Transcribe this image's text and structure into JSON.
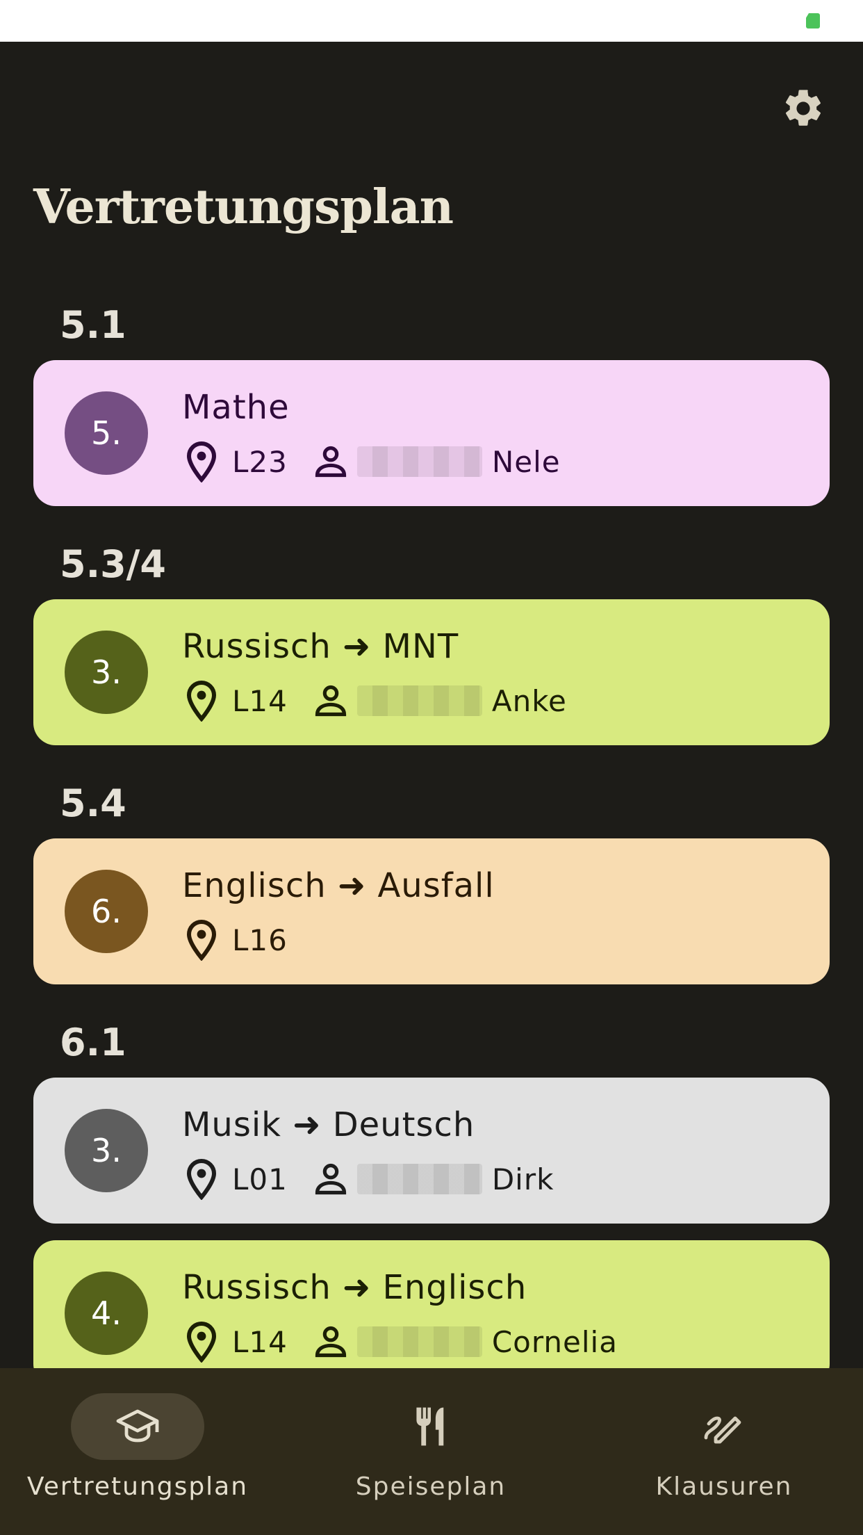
{
  "app": {
    "title": "Vertretungsplan"
  },
  "colors": {
    "background": "#1d1c18",
    "pink_card": "#f7d6f7",
    "green_card": "#d8ea80",
    "orange_card": "#f8dcb1",
    "grey_card": "#e1e1e1",
    "nav_bar": "#2f2a1a"
  },
  "groups": [
    {
      "class": "5.1",
      "entries": [
        {
          "period": "5.",
          "subject": "Mathe",
          "room": "L23",
          "teacher": "Nele",
          "color": "pink"
        }
      ]
    },
    {
      "class": "5.3/4",
      "entries": [
        {
          "period": "3.",
          "subject": "Russisch ➜ MNT",
          "room": "L14",
          "teacher": "Anke",
          "color": "green"
        }
      ]
    },
    {
      "class": "5.4",
      "entries": [
        {
          "period": "6.",
          "subject": "Englisch ➜ Ausfall",
          "room": "L16",
          "teacher": "",
          "color": "orange"
        }
      ]
    },
    {
      "class": "6.1",
      "entries": [
        {
          "period": "3.",
          "subject": "Musik ➜ Deutsch",
          "room": "L01",
          "teacher": "Dirk",
          "color": "grey"
        },
        {
          "period": "4.",
          "subject": "Russisch ➜ Englisch",
          "room": "L14",
          "teacher": "Cornelia",
          "color": "green"
        }
      ]
    }
  ],
  "icons": {
    "settings": "gear-icon",
    "room": "location-pin-icon",
    "teacher": "person-icon"
  },
  "nav": {
    "items": [
      {
        "label": "Vertretungsplan",
        "icon": "graduation-cap-icon",
        "active": true
      },
      {
        "label": "Speiseplan",
        "icon": "fork-knife-icon",
        "active": false
      },
      {
        "label": "Klausuren",
        "icon": "pen-icon",
        "active": false
      }
    ]
  }
}
